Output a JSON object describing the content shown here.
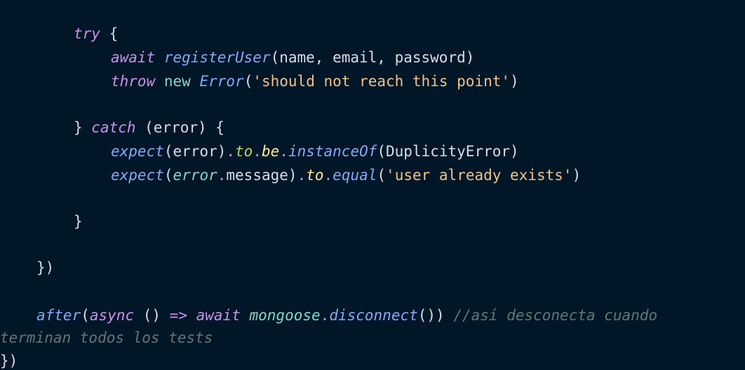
{
  "code": {
    "l1": {
      "kw_try": "try",
      "brace": " {"
    },
    "l2": {
      "kw_await": "await",
      "fn": "registerUser",
      "args": "(name, email, password)"
    },
    "l3": {
      "kw_throw": "throw",
      "kw_new": "new",
      "cls": "Error",
      "p1": "(",
      "str": "'should not reach this point'",
      "p2": ")"
    },
    "l4": {
      "close": "} ",
      "kw_catch": "catch",
      "rest": " (error) {"
    },
    "l5": {
      "fn": "expect",
      "arg": "(error)",
      "to": "to",
      "be": "be",
      "m": "instanceOf",
      "args": "(DuplicityError)"
    },
    "l6": {
      "fn": "expect",
      "p1": "(",
      "err": "error",
      "msg": "message",
      "p2": ")",
      "to": "to",
      "eq": "equal",
      "p3": "(",
      "str": "'user already exists'",
      "p4": ")"
    },
    "l7": {
      "close": "}"
    },
    "l8": {
      "close": "})"
    },
    "l9": {
      "fn": "after",
      "p1": "(",
      "kw_async": "async",
      "p2": " () ",
      "arrow": "=>",
      "kw_await": "await",
      "obj": "mongoose",
      "m": "disconnect",
      "p3": "())",
      "comment": "//así desconecta cuando"
    },
    "l10": {
      "comment": "terminan todos los tests"
    },
    "l11": {
      "close": "})"
    }
  }
}
